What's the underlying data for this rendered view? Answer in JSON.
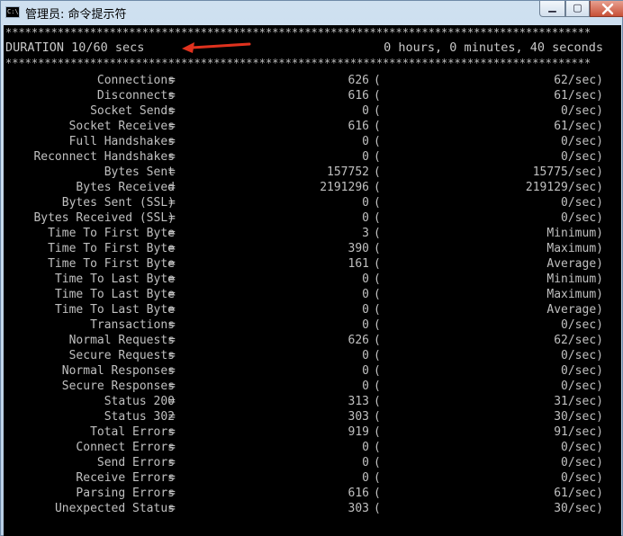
{
  "window": {
    "title": "管理员: 命令提示符",
    "icon_label": "C:\\",
    "minimize_glyph": "▁",
    "maximize_glyph": "▢"
  },
  "console": {
    "separator": "******************************************************************************************",
    "duration_left": "DURATION 10/60 secs",
    "duration_right": "0 hours, 0 minutes, 40 seconds",
    "rows": [
      {
        "label": "Connections",
        "eq": "=",
        "value": "626",
        "paren": "(",
        "rate": "62/sec)"
      },
      {
        "label": "Disconnects",
        "eq": "=",
        "value": "616",
        "paren": "(",
        "rate": "61/sec)"
      },
      {
        "label": "Socket Sends",
        "eq": "=",
        "value": "0",
        "paren": "(",
        "rate": "0/sec)"
      },
      {
        "label": "Socket Receives",
        "eq": "=",
        "value": "616",
        "paren": "(",
        "rate": "61/sec)"
      },
      {
        "label": "Full Handshakes",
        "eq": "=",
        "value": "0",
        "paren": "(",
        "rate": "0/sec)"
      },
      {
        "label": "Reconnect Handshakes",
        "eq": "=",
        "value": "0",
        "paren": "(",
        "rate": "0/sec)"
      },
      {
        "label": "Bytes Sent",
        "eq": "=",
        "value": "157752",
        "paren": "(",
        "rate": "15775/sec)"
      },
      {
        "label": "Bytes Received",
        "eq": "=",
        "value": "2191296",
        "paren": "(",
        "rate": "219129/sec)"
      },
      {
        "label": "Bytes Sent (SSL)",
        "eq": "=",
        "value": "0",
        "paren": "(",
        "rate": "0/sec)"
      },
      {
        "label": "Bytes Received (SSL)",
        "eq": "=",
        "value": "0",
        "paren": "(",
        "rate": "0/sec)"
      },
      {
        "label": "Time To First Byte",
        "eq": "=",
        "value": "3",
        "paren": "(",
        "rate": "Minimum)"
      },
      {
        "label": "Time To First Byte",
        "eq": "=",
        "value": "390",
        "paren": "(",
        "rate": "Maximum)"
      },
      {
        "label": "Time To First Byte",
        "eq": "=",
        "value": "161",
        "paren": "(",
        "rate": "Average)"
      },
      {
        "label": "Time To Last Byte",
        "eq": "=",
        "value": "0",
        "paren": "(",
        "rate": "Minimum)"
      },
      {
        "label": "Time To Last Byte",
        "eq": "=",
        "value": "0",
        "paren": "(",
        "rate": "Maximum)"
      },
      {
        "label": "Time To Last Byte",
        "eq": "=",
        "value": "0",
        "paren": "(",
        "rate": "Average)"
      },
      {
        "label": "Transactions",
        "eq": "=",
        "value": "0",
        "paren": "(",
        "rate": "0/sec)"
      },
      {
        "label": "Normal Requests",
        "eq": "=",
        "value": "626",
        "paren": "(",
        "rate": "62/sec)"
      },
      {
        "label": "Secure Requests",
        "eq": "=",
        "value": "0",
        "paren": "(",
        "rate": "0/sec)"
      },
      {
        "label": "Normal Responses",
        "eq": "=",
        "value": "0",
        "paren": "(",
        "rate": "0/sec)"
      },
      {
        "label": "Secure Responses",
        "eq": "=",
        "value": "0",
        "paren": "(",
        "rate": "0/sec)"
      },
      {
        "label": "Status 200",
        "eq": "=",
        "value": "313",
        "paren": "(",
        "rate": "31/sec)"
      },
      {
        "label": "Status 302",
        "eq": "=",
        "value": "303",
        "paren": "(",
        "rate": "30/sec)"
      },
      {
        "label": "Total Errors",
        "eq": "=",
        "value": "919",
        "paren": "(",
        "rate": "91/sec)"
      },
      {
        "label": "Connect Errors",
        "eq": "=",
        "value": "0",
        "paren": "(",
        "rate": "0/sec)"
      },
      {
        "label": "Send Errors",
        "eq": "=",
        "value": "0",
        "paren": "(",
        "rate": "0/sec)"
      },
      {
        "label": "Receive Errors",
        "eq": "=",
        "value": "0",
        "paren": "(",
        "rate": "0/sec)"
      },
      {
        "label": "Parsing Errors",
        "eq": "=",
        "value": "616",
        "paren": "(",
        "rate": "61/sec)"
      },
      {
        "label": "Unexpected Status",
        "eq": "=",
        "value": "303",
        "paren": "(",
        "rate": "30/sec)"
      }
    ]
  },
  "colors": {
    "console_bg": "#000000",
    "console_text": "#c0c0c0",
    "annotation_arrow": "#e0321e",
    "close_button": "#c75036"
  }
}
